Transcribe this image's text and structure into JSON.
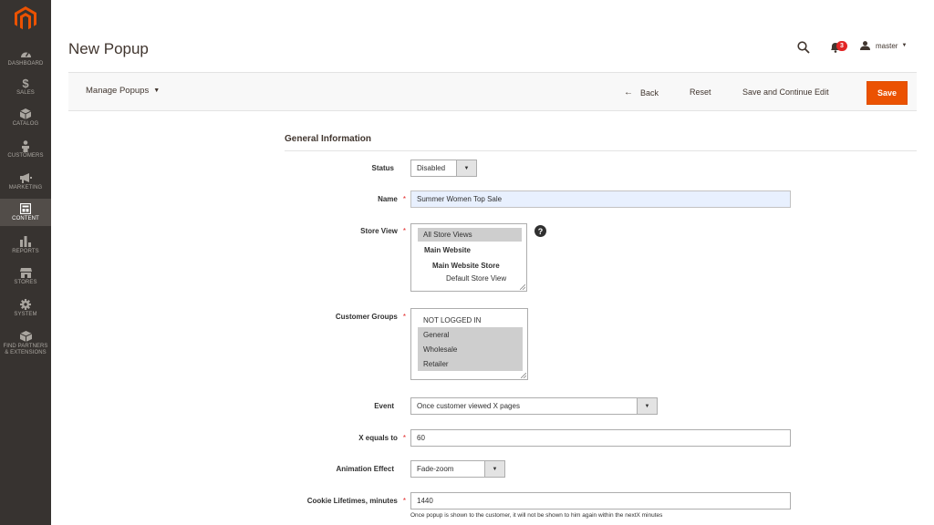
{
  "sidebar": {
    "items": [
      {
        "label": "DASHBOARD",
        "icon": "dashboard-icon"
      },
      {
        "label": "SALES",
        "icon": "dollar-icon"
      },
      {
        "label": "CATALOG",
        "icon": "cube-icon"
      },
      {
        "label": "CUSTOMERS",
        "icon": "person-icon"
      },
      {
        "label": "MARKETING",
        "icon": "megaphone-icon"
      },
      {
        "label": "CONTENT",
        "icon": "layout-icon"
      },
      {
        "label": "REPORTS",
        "icon": "bar-chart-icon"
      },
      {
        "label": "STORES",
        "icon": "storefront-icon"
      },
      {
        "label": "SYSTEM",
        "icon": "gear-icon"
      },
      {
        "label": "FIND PARTNERS",
        "label2": "& EXTENSIONS",
        "icon": "box-icon"
      }
    ],
    "active": "CONTENT"
  },
  "header": {
    "title": "New Popup",
    "notifications_count": "3",
    "user": "master"
  },
  "action_bar": {
    "manage_label": "Manage Popups",
    "back_label": "Back",
    "reset_label": "Reset",
    "save_continue_label": "Save and Continue Edit",
    "save_label": "Save"
  },
  "form": {
    "section_title": "General Information",
    "status": {
      "label": "Status",
      "value": "Disabled"
    },
    "name": {
      "label": "Name",
      "value": "Summer Women Top Sale"
    },
    "store_view": {
      "label": "Store View",
      "options": [
        "All Store Views",
        "Main Website",
        "Main Website Store",
        "Default Store View"
      ]
    },
    "customer_groups": {
      "label": "Customer Groups",
      "options": [
        "NOT LOGGED IN",
        "General",
        "Wholesale",
        "Retailer"
      ]
    },
    "event": {
      "label": "Event",
      "value": "Once customer viewed X pages"
    },
    "x_equals": {
      "label": "X equals to",
      "value": "60"
    },
    "animation": {
      "label": "Animation Effect",
      "value": "Fade-zoom"
    },
    "cookie": {
      "label": "Cookie Lifetimes, minutes",
      "value": "1440",
      "note": "Once popup is shown to the customer, it will not be shown to him again within the nextX minutes"
    },
    "required_mark": "*",
    "help_mark": "?"
  },
  "colors": {
    "sidebar_bg": "#373330",
    "accent": "#eb5202",
    "required": "#e22626"
  }
}
